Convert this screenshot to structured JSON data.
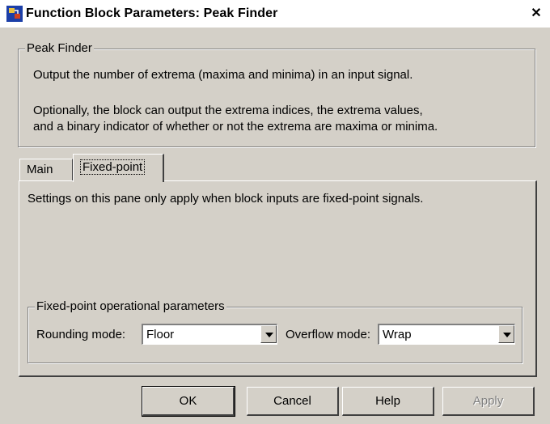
{
  "window": {
    "title": "Function Block Parameters: Peak Finder",
    "close_glyph": "✕"
  },
  "block": {
    "group_label": "Peak Finder",
    "description_1": "Output the number of extrema (maxima and minima) in an input signal.",
    "description_2a": "Optionally, the block can output the extrema indices, the extrema values,",
    "description_2b": "and a binary indicator of whether or not the extrema are maxima or minima."
  },
  "tabs": [
    {
      "label": "Main",
      "active": false
    },
    {
      "label": "Fixed-point",
      "active": true
    }
  ],
  "pane": {
    "info": "Settings on this pane only apply when block inputs are fixed-point signals.",
    "group_label": "Fixed-point operational parameters",
    "rounding_label": "Rounding mode:",
    "rounding_value": "Floor",
    "overflow_label": "Overflow mode:",
    "overflow_value": "Wrap"
  },
  "buttons": {
    "ok": "OK",
    "cancel": "Cancel",
    "help": "Help",
    "apply": "Apply"
  },
  "icons": {
    "app": "simulink-block-icon",
    "close": "close-icon",
    "dropdown": "chevron-down-icon"
  }
}
